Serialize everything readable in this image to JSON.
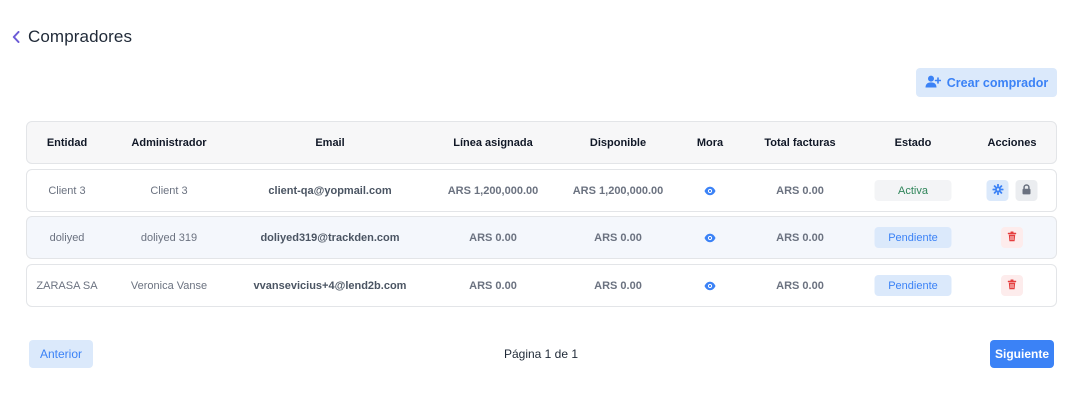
{
  "header": {
    "title": "Compradores",
    "back_icon": "chevron-left-icon"
  },
  "create_button": {
    "label": "Crear comprador",
    "icon": "user-plus-icon"
  },
  "table": {
    "columns": [
      "Entidad",
      "Administrador",
      "Email",
      "Línea asignada",
      "Disponible",
      "Mora",
      "Total facturas",
      "Estado",
      "Acciones"
    ],
    "rows": [
      {
        "entidad": "Client 3",
        "administrador": "Client 3",
        "email": "client-qa@yopmail.com",
        "linea": "ARS 1,200,000.00",
        "disponible": "ARS 1,200,000.00",
        "mora_icon": "eye-icon",
        "total": "ARS 0.00",
        "estado": "Activa",
        "actions": [
          "gear-icon",
          "lock-icon"
        ]
      },
      {
        "entidad": "doliyed",
        "administrador": "doliyed 319",
        "email": "doliyed319@trackden.com",
        "linea": "ARS 0.00",
        "disponible": "ARS 0.00",
        "mora_icon": "eye-icon",
        "total": "ARS 0.00",
        "estado": "Pendiente",
        "actions": [
          "trash-icon"
        ]
      },
      {
        "entidad": "ZARASA SA",
        "administrador": "Veronica Vanse",
        "email": "vvansevicius+4@lend2b.com",
        "linea": "ARS 0.00",
        "disponible": "ARS 0.00",
        "mora_icon": "eye-icon",
        "total": "ARS 0.00",
        "estado": "Pendiente",
        "actions": [
          "trash-icon"
        ]
      }
    ]
  },
  "pagination": {
    "prev_label": "Anterior",
    "page_info": "Página 1 de 1",
    "next_label": "Siguiente"
  },
  "colors": {
    "accent": "#3b82f6",
    "accent_light": "#dbe9fb",
    "active_green": "#2f855a",
    "danger": "#e53e3e"
  }
}
